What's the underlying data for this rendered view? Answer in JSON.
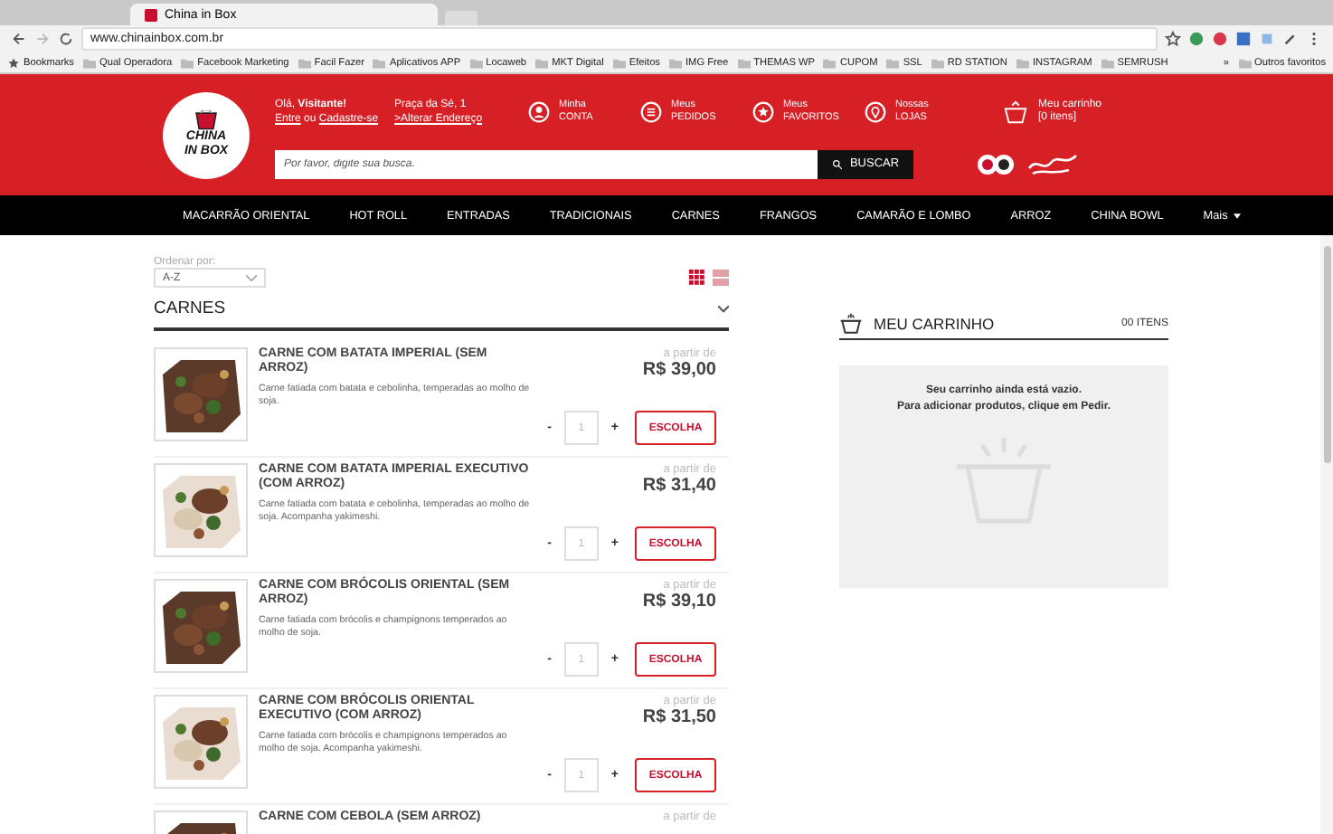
{
  "browser": {
    "tab_title": "China in Box",
    "url": "www.chinainbox.com.br",
    "bookmarks": [
      "Bookmarks",
      "Qual Operadora",
      "Facebook Marketing",
      "Facil Fazer",
      "Aplicativos APP",
      "Locaweb",
      "MKT Digital",
      "Efeitos",
      "IMG Free",
      "THEMAS WP",
      "CUPOM",
      "SSL",
      "RD STATION",
      "INSTAGRAM",
      "SEMRUSH"
    ],
    "more": "»",
    "other_bookmarks": "Outros favoritos"
  },
  "header": {
    "logo_lines": [
      "CHINA",
      "IN BOX"
    ],
    "greeting": "Olá, **Visitante!**",
    "login_link": "Entre",
    "or_text": "ou",
    "signup_link": "Cadastre-se",
    "address": "Praça da Sé, 1",
    "change_address_link": ">Alterar Endereço",
    "shortcuts": [
      {
        "kind": "account",
        "line1": "Minha",
        "line2": "CONTA"
      },
      {
        "kind": "orders",
        "line1": "Meus",
        "line2": "PEDIDOS"
      },
      {
        "kind": "favorites",
        "line1": "Meus",
        "line2": "FAVORITOS"
      },
      {
        "kind": "stores",
        "line1": "Nossas",
        "line2": "LOJAS"
      }
    ],
    "cart_label": "Meu carrinho",
    "cart_count": "[0 itens]",
    "search": {
      "placeholder": "Por favor, digite sua busca.",
      "button": "BUSCAR"
    }
  },
  "nav": [
    {
      "label": "MACARRÃO ORIENTAL",
      "dropdown": false
    },
    {
      "label": "HOT ROLL",
      "dropdown": false
    },
    {
      "label": "ENTRADAS",
      "dropdown": false
    },
    {
      "label": "TRADICIONAIS",
      "dropdown": false
    },
    {
      "label": "CARNES",
      "dropdown": false
    },
    {
      "label": "FRANGOS",
      "dropdown": false
    },
    {
      "label": "CAMARÃO E LOMBO",
      "dropdown": false
    },
    {
      "label": "ARROZ",
      "dropdown": false
    },
    {
      "label": "CHINA BOWL",
      "dropdown": false
    },
    {
      "label": "Mais",
      "dropdown": true
    }
  ],
  "sort": {
    "label": "Ordenar por:",
    "value": "A-Z"
  },
  "view_toggle": [
    {
      "kind": "grid",
      "selected": true
    },
    {
      "kind": "list",
      "selected": false
    }
  ],
  "category": {
    "title": "CARNES",
    "expanded": true
  },
  "products": [
    {
      "name": "CARNE COM BATATA IMPERIAL (SEM ARROZ)",
      "description": "Carne fatiada com batata e cebolinha, temperadas ao molho de soja.",
      "price_prefix": "a partir de",
      "price": "R$ 39,00",
      "minus": "-",
      "quantity": "1",
      "plus": "+",
      "button": "ESCOLHA"
    },
    {
      "name": "CARNE COM BATATA IMPERIAL EXECUTIVO (COM ARROZ)",
      "description": "Carne fatiada com batata e cebolinha, temperadas ao molho de soja. Acompanha yakimeshi.",
      "price_prefix": "a partir de",
      "price": "R$ 31,40",
      "minus": "-",
      "quantity": "1",
      "plus": "+",
      "button": "ESCOLHA"
    },
    {
      "name": "CARNE COM BRÓCOLIS ORIENTAL (SEM ARROZ)",
      "description": "Carne fatiada com brócolis e champignons temperados ao molho de soja.",
      "price_prefix": "a partir de",
      "price": "R$ 39,10",
      "minus": "-",
      "quantity": "1",
      "plus": "+",
      "button": "ESCOLHA"
    },
    {
      "name": "CARNE COM BRÓCOLIS ORIENTAL EXECUTIVO (COM ARROZ)",
      "description": "Carne fatiada com brócolis e champignons temperados ao molho de soja. Acompanha yakimeshi.",
      "price_prefix": "a partir de",
      "price": "R$ 31,50",
      "minus": "-",
      "quantity": "1",
      "plus": "+",
      "button": "ESCOLHA"
    },
    {
      "name": "CARNE COM CEBOLA (SEM ARROZ)",
      "price_prefix": "a partir de"
    }
  ],
  "cart": {
    "title": "MEU CARRINHO",
    "count": "00 ITENS",
    "empty_lines": [
      "Seu carrinho ainda está vazio.",
      "Para adicionar produtos, clique em Pedir."
    ]
  }
}
